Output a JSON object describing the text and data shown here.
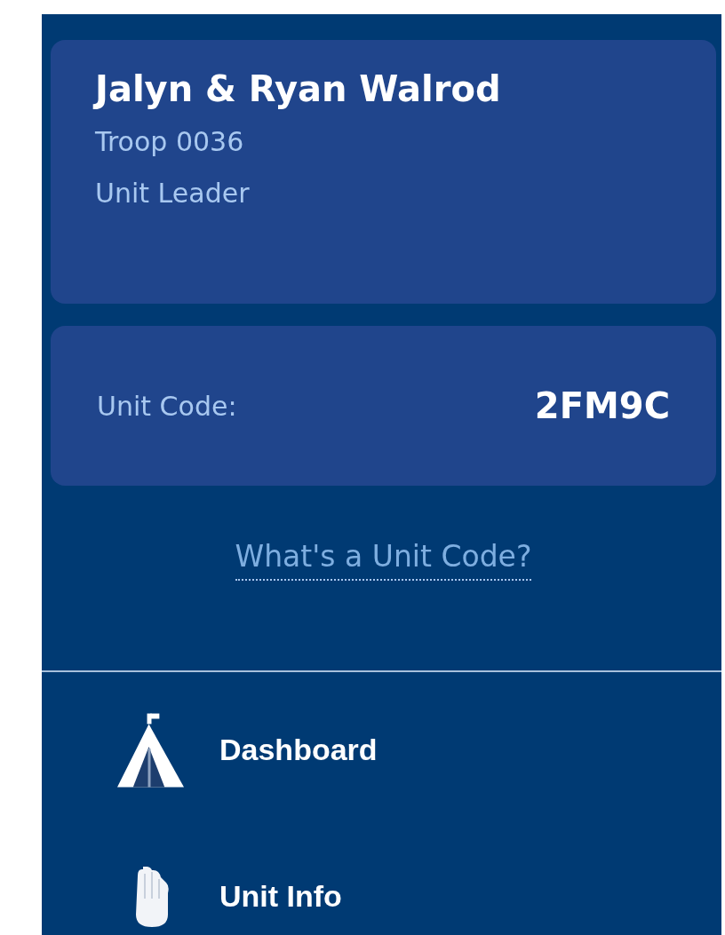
{
  "profile": {
    "name": "Jalyn & Ryan Walrod",
    "unit": "Troop 0036",
    "role": "Unit Leader"
  },
  "unit_code": {
    "label": "Unit Code:",
    "value": "2FM9C"
  },
  "help_link": "What's a Unit Code?",
  "nav": [
    {
      "label": "Dashboard",
      "kind": "tent"
    },
    {
      "label": "Unit Info",
      "kind": "hand"
    }
  ]
}
